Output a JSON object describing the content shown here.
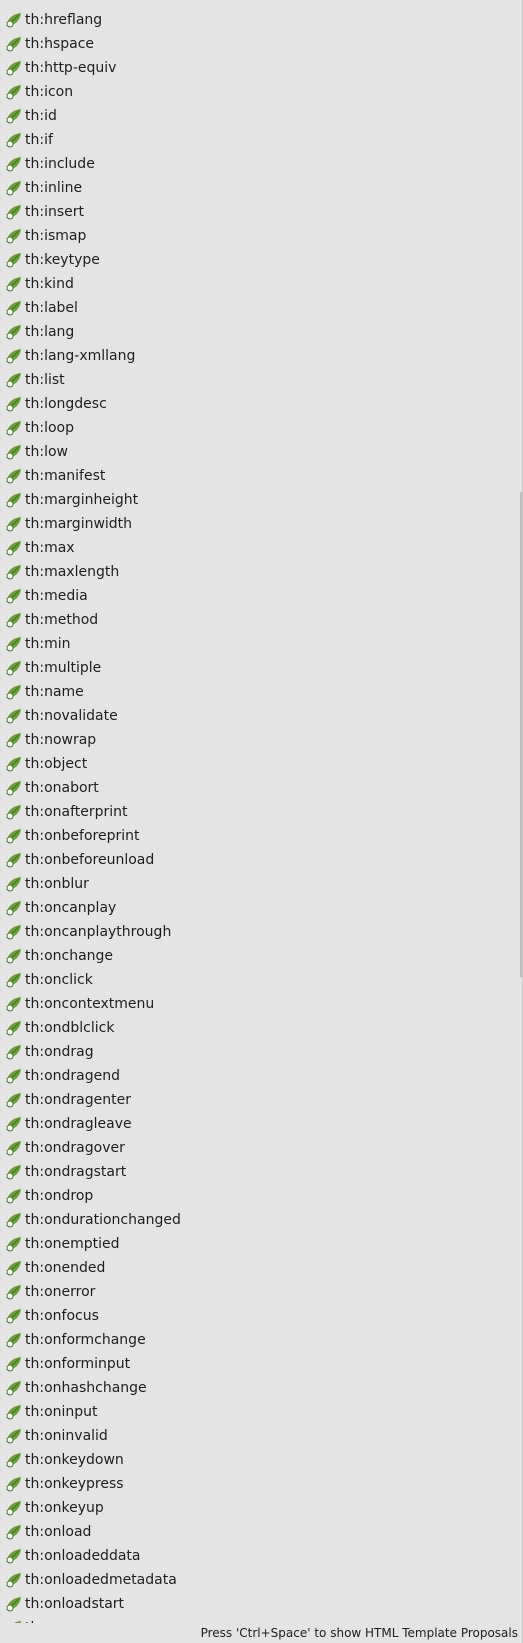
{
  "items": [
    "th:hreflang",
    "th:hspace",
    "th:http-equiv",
    "th:icon",
    "th:id",
    "th:if",
    "th:include",
    "th:inline",
    "th:insert",
    "th:ismap",
    "th:keytype",
    "th:kind",
    "th:label",
    "th:lang",
    "th:lang-xmllang",
    "th:list",
    "th:longdesc",
    "th:loop",
    "th:low",
    "th:manifest",
    "th:marginheight",
    "th:marginwidth",
    "th:max",
    "th:maxlength",
    "th:media",
    "th:method",
    "th:min",
    "th:multiple",
    "th:name",
    "th:novalidate",
    "th:nowrap",
    "th:object",
    "th:onabort",
    "th:onafterprint",
    "th:onbeforeprint",
    "th:onbeforeunload",
    "th:onblur",
    "th:oncanplay",
    "th:oncanplaythrough",
    "th:onchange",
    "th:onclick",
    "th:oncontextmenu",
    "th:ondblclick",
    "th:ondrag",
    "th:ondragend",
    "th:ondragenter",
    "th:ondragleave",
    "th:ondragover",
    "th:ondragstart",
    "th:ondrop",
    "th:ondurationchanged",
    "th:onemptied",
    "th:onended",
    "th:onerror",
    "th:onfocus",
    "th:onformchange",
    "th:onforminput",
    "th:onhashchange",
    "th:oninput",
    "th:oninvalid",
    "th:onkeydown",
    "th:onkeypress",
    "th:onkeyup",
    "th:onload",
    "th:onloadeddata",
    "th:onloadedmetadata",
    "th:onloadstart",
    "th:"
  ],
  "item_icon": "thymeleaf-leaf-icon",
  "colors": {
    "leaf": "#6aa03a",
    "leaf_dark": "#3f7a1e",
    "background": "#e4e4e4"
  },
  "status": {
    "hint": "Press 'Ctrl+Space' to show HTML Template Proposals"
  }
}
